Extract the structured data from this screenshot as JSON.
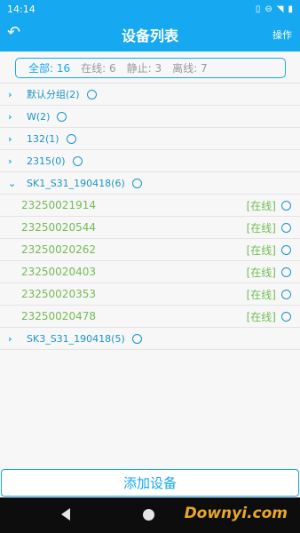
{
  "statusbar": {
    "time": "14:14",
    "icons": [
      "vibrate-icon",
      "minus-circle-icon",
      "wifi-icon",
      "battery-icon"
    ]
  },
  "header": {
    "back_icon": "back-arrow-icon",
    "title": "设备列表",
    "action": "操作"
  },
  "filters": [
    {
      "label": "全部: 16",
      "active": true
    },
    {
      "label": "在线: 6",
      "active": false
    },
    {
      "label": "静止: 3",
      "active": false
    },
    {
      "label": "离线: 7",
      "active": false
    }
  ],
  "groups": [
    {
      "name": "默认分组(2)"
    },
    {
      "name": "W(2)"
    },
    {
      "name": "132(1)"
    },
    {
      "name": "2315(0)"
    },
    {
      "name": "SK1_S31_190418(6)"
    }
  ],
  "devices": [
    {
      "id": "23250021914",
      "status": "[在线]"
    },
    {
      "id": "23250020544",
      "status": "[在线]"
    },
    {
      "id": "23250020262",
      "status": "[在线]"
    },
    {
      "id": "23250020403",
      "status": "[在线]"
    },
    {
      "id": "23250020353",
      "status": "[在线]"
    },
    {
      "id": "23250020478",
      "status": "[在线]"
    }
  ],
  "groups_after": [
    {
      "name": "SK3_S31_190418(5)"
    }
  ],
  "add_button": "添加设备",
  "watermark": "Downyi.com",
  "colors": {
    "primary": "#16a8f0",
    "online": "#72bd52",
    "group_text": "#1b94cc"
  }
}
